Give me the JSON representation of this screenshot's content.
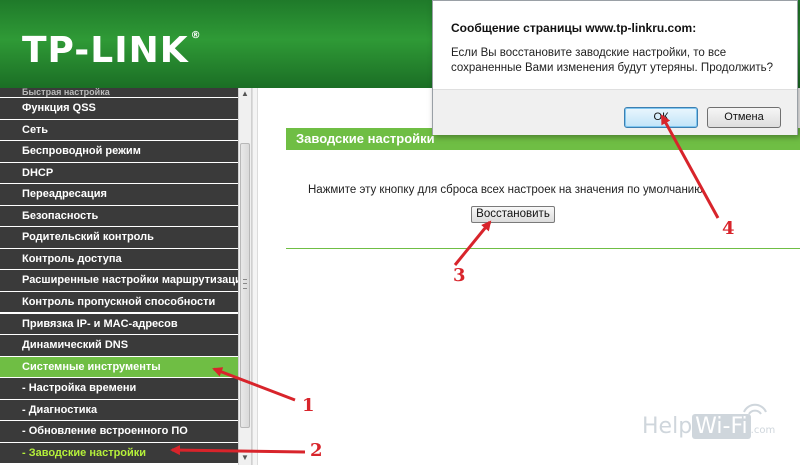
{
  "header": {
    "logo": "TP-LINK",
    "logo_mark": "®"
  },
  "sidebar": {
    "cut_item": "Быстрая настройка",
    "items": [
      {
        "label": "Функция QSS"
      },
      {
        "label": "Сеть"
      },
      {
        "label": "Беспроводной режим"
      },
      {
        "label": "DHCP"
      },
      {
        "label": "Переадресация"
      },
      {
        "label": "Безопасность"
      },
      {
        "label": "Родительский контроль"
      },
      {
        "label": "Контроль доступа"
      },
      {
        "label": "Расширенные настройки маршрутизации"
      },
      {
        "label": "Контроль пропускной способности"
      },
      {
        "label": "Привязка IP- и MAC-адресов"
      },
      {
        "label": "Динамический DNS"
      },
      {
        "label": "Системные инструменты"
      },
      {
        "label": "- Настройка времени"
      },
      {
        "label": "- Диагностика"
      },
      {
        "label": "- Обновление встроенного ПО"
      },
      {
        "label": "- Заводские настройки"
      }
    ]
  },
  "main": {
    "section_title": "Заводские настройки",
    "instruction": "Нажмите эту кнопку для сброса всех настроек на значения по умолчанию.",
    "restore_button": "Восстановить"
  },
  "dialog": {
    "title": "Сообщение страницы www.tp-linkru.com:",
    "message": "Если Вы восстановите заводские настройки, то все сохраненные Вами изменения будут утеряны. Продолжить?",
    "ok": "ОК",
    "cancel": "Отмена"
  },
  "annotations": {
    "n1": "1",
    "n2": "2",
    "n3": "3",
    "n4": "4",
    "color": "#d8242b"
  },
  "watermark": {
    "help": "Help",
    "wifi": "Wi-Fi",
    "dotcom": ".com"
  }
}
